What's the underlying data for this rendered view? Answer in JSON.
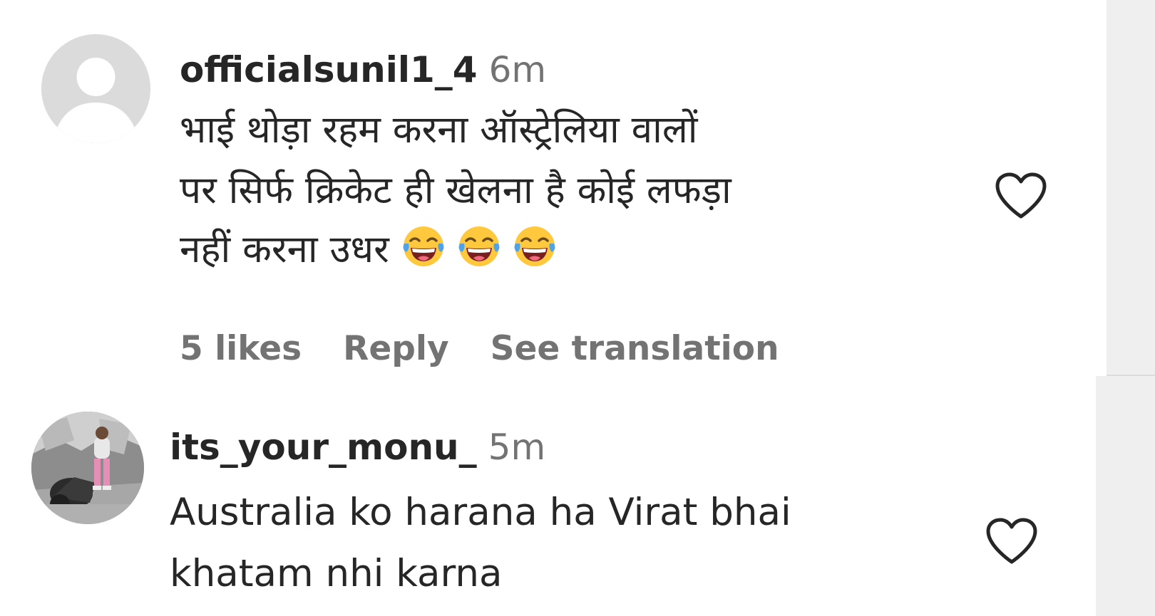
{
  "comments": [
    {
      "username": "officialsunil1_4",
      "time": "6m",
      "lines": [
        "भाई थोड़ा रहम करना ऑस्ट्रेलिया वालों",
        "पर सिर्फ क्रिकेट ही खेलना है कोई लफड़ा",
        "नहीं करना उधर"
      ],
      "emojis": [
        "face-with-tears-of-joy",
        "face-with-tears-of-joy",
        "face-with-tears-of-joy"
      ],
      "likes_label": "5 likes",
      "reply_label": "Reply",
      "translate_label": "See translation",
      "like_icon": "heart-outline-icon"
    },
    {
      "username": "its_your_monu_",
      "time": "5m",
      "lines": [
        "Australia ko harana ha Virat bhai",
        "khatam nhi karna"
      ],
      "like_icon": "heart-outline-icon"
    }
  ],
  "colors": {
    "text_primary": "#262626",
    "text_secondary": "#737373",
    "panel_gray": "#efefef"
  }
}
